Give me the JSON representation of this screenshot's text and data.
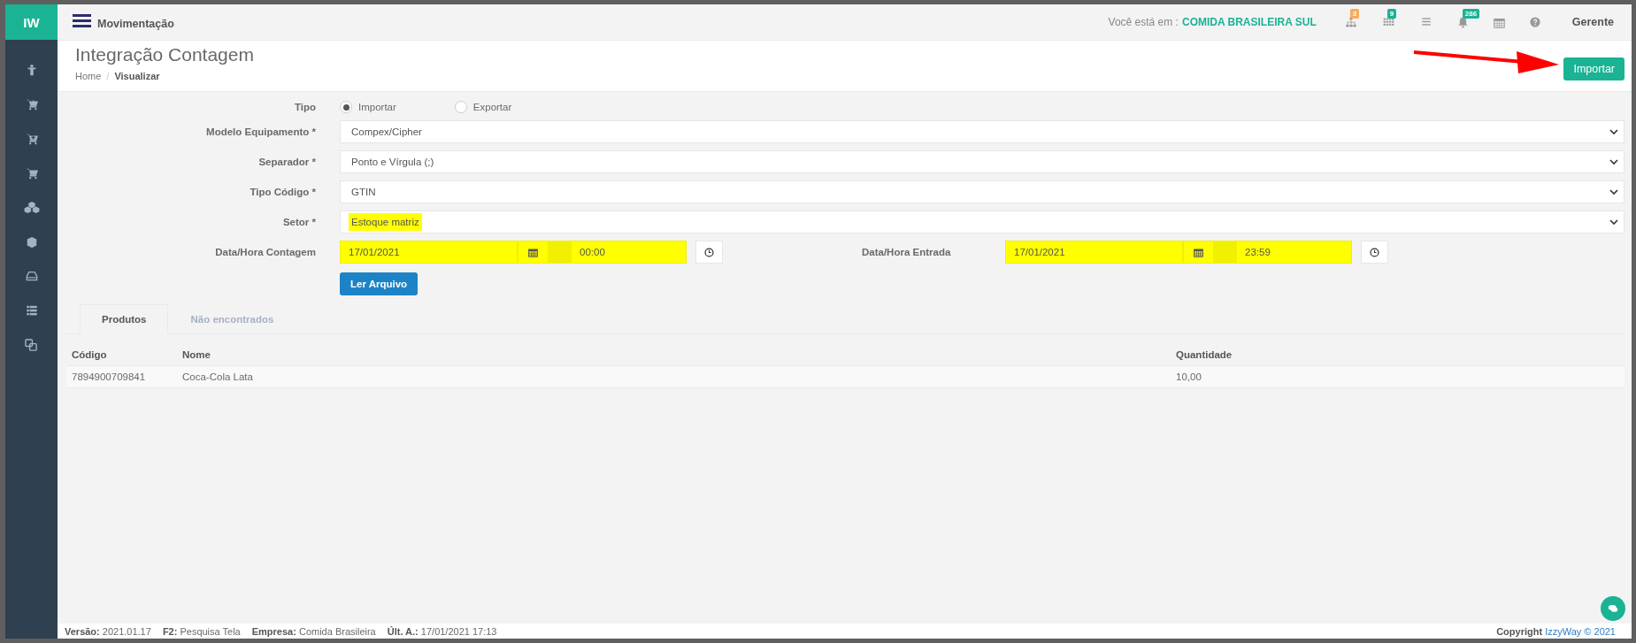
{
  "sidebar": {
    "logo": "IW",
    "items": [
      {
        "kind": "figure"
      },
      {
        "kind": "cart-down"
      },
      {
        "kind": "cart-plus"
      },
      {
        "kind": "cart"
      },
      {
        "kind": "cubes"
      },
      {
        "kind": "cube"
      },
      {
        "kind": "drive"
      },
      {
        "kind": "list"
      },
      {
        "kind": "copy"
      }
    ]
  },
  "topbar": {
    "title": "Movimentação",
    "location_label": "Você está em :",
    "location": "COMIDA BRASILEIRA SUL",
    "icons": [
      {
        "kind": "sitemap",
        "badge": "3",
        "color": "#f8ac59"
      },
      {
        "kind": "grid",
        "badge": "9",
        "color": "#1ab394"
      },
      {
        "kind": "lines"
      },
      {
        "kind": "bell",
        "badge": "286",
        "color": "#1ab394"
      },
      {
        "kind": "calendar"
      },
      {
        "kind": "help"
      }
    ],
    "user": "Gerente"
  },
  "header": {
    "title": "Integração Contagem",
    "breadcrumb": [
      "Home",
      "Visualizar"
    ],
    "breadcrumb_separator": "/",
    "button": "Importar"
  },
  "form": {
    "tipo": {
      "label": "Tipo",
      "options": [
        {
          "label": "Importar",
          "selected": true
        },
        {
          "label": "Exportar",
          "selected": false
        }
      ]
    },
    "selects": [
      {
        "label": "Modelo Equipamento *",
        "value": "Compex/Cipher",
        "highlighted": false
      },
      {
        "label": "Separador *",
        "value": "Ponto e Vírgula (;)",
        "highlighted": false
      },
      {
        "label": "Tipo Código *",
        "value": "GTIN",
        "highlighted": false
      },
      {
        "label": "Setor *",
        "value": "Estoque matriz",
        "highlighted": true
      }
    ],
    "dates": [
      {
        "label": "Data/Hora Contagem",
        "date": "17/01/2021",
        "time": "00:00",
        "highlighted": true
      },
      {
        "label": "Data/Hora Entrada",
        "date": "17/01/2021",
        "time": "23:59",
        "highlighted": true
      }
    ],
    "button": "Ler Arquivo"
  },
  "tabs": [
    {
      "label": "Produtos",
      "selected": true
    },
    {
      "label": "Não encontrados",
      "selected": false
    }
  ],
  "table": {
    "columns": [
      "Código",
      "Nome",
      "Quantidade"
    ],
    "rows": [
      [
        "7894900709841",
        "Coca-Cola Lata",
        "10,00"
      ]
    ]
  },
  "footer": {
    "items": [
      "**Versão:** 2021.01.17",
      "**F2:** Pesquisa Tela",
      "**Empresa:** Comida Brasileira",
      "**Últ. A.:** 17/01/2021 17:13"
    ],
    "copyright": "**Copyright** IzzyWay © 2021"
  }
}
